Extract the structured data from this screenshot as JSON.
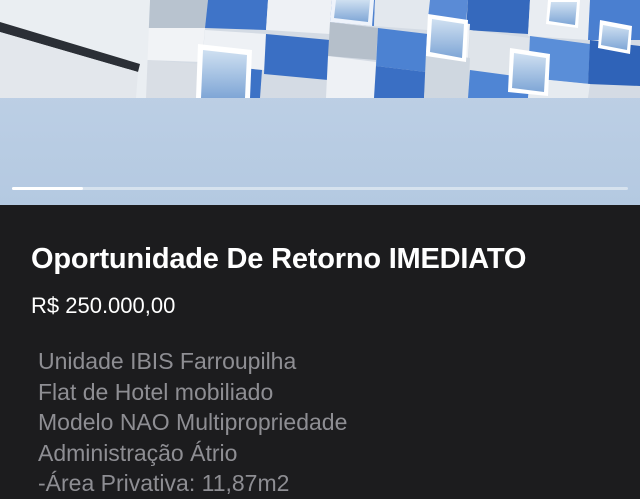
{
  "listing": {
    "photo_carousel": {
      "image_subject": "building-facade-photo",
      "current_index": 1,
      "progress_fraction": 0.115
    },
    "title": "Oportunidade De Retorno IMEDIATO",
    "price": "R$ 250.000,00",
    "description_lines": [
      "Unidade IBIS Farroupilha",
      "Flat de Hotel mobiliado",
      "Modelo NAO Multipropriedade",
      "Administração Átrio",
      "-Área Privativa: 11,87m2"
    ]
  },
  "colors": {
    "background": "#1c1c1e",
    "title": "#ffffff",
    "price": "#ffffff",
    "description": "#8e8e93",
    "facade_blue": "#3f74c8",
    "facade_gray": "#c8d0da",
    "sky": "#b9cde3"
  }
}
